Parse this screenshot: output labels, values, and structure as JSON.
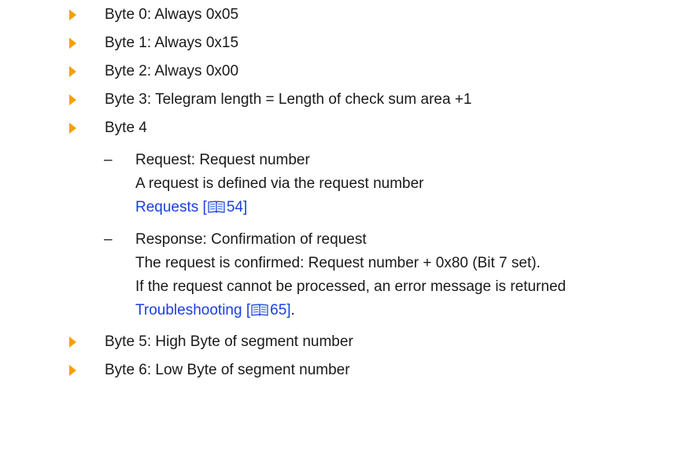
{
  "bullets_top": [
    {
      "text": "Byte 0: Always 0x05"
    },
    {
      "text": "Byte 1: Always 0x15"
    },
    {
      "text": "Byte 2: Always 0x00"
    },
    {
      "text": "Byte 3: Telegram length = Length of check sum area +1"
    },
    {
      "text": "Byte 4"
    }
  ],
  "sub_request": {
    "dash": "–",
    "line1": "Request: Request number",
    "line2": "A request is defined via the request number",
    "link": {
      "label": "Requests",
      "open": " [",
      "page": "54",
      "close": "]"
    }
  },
  "sub_response": {
    "dash": "–",
    "line1": "Response: Confirmation of request",
    "line2": "The request is confirmed: Request number + 0x80 (Bit 7 set).",
    "line3": "If the request cannot be processed, an error message is returned",
    "link": {
      "label": "Troubleshooting",
      "open": " [",
      "page": "65",
      "close": "]"
    },
    "trailing": "."
  },
  "bullets_bottom": [
    {
      "text": "Byte 5: High Byte of segment number"
    },
    {
      "text": "Byte 6: Low Byte of segment number"
    }
  ],
  "colors": {
    "bullet": "#f5a000",
    "link": "#1a3fe0",
    "text": "#1a1a1a"
  },
  "icons": {
    "bullet": "orange-triangle-bullet-icon",
    "reference": "book-icon"
  }
}
